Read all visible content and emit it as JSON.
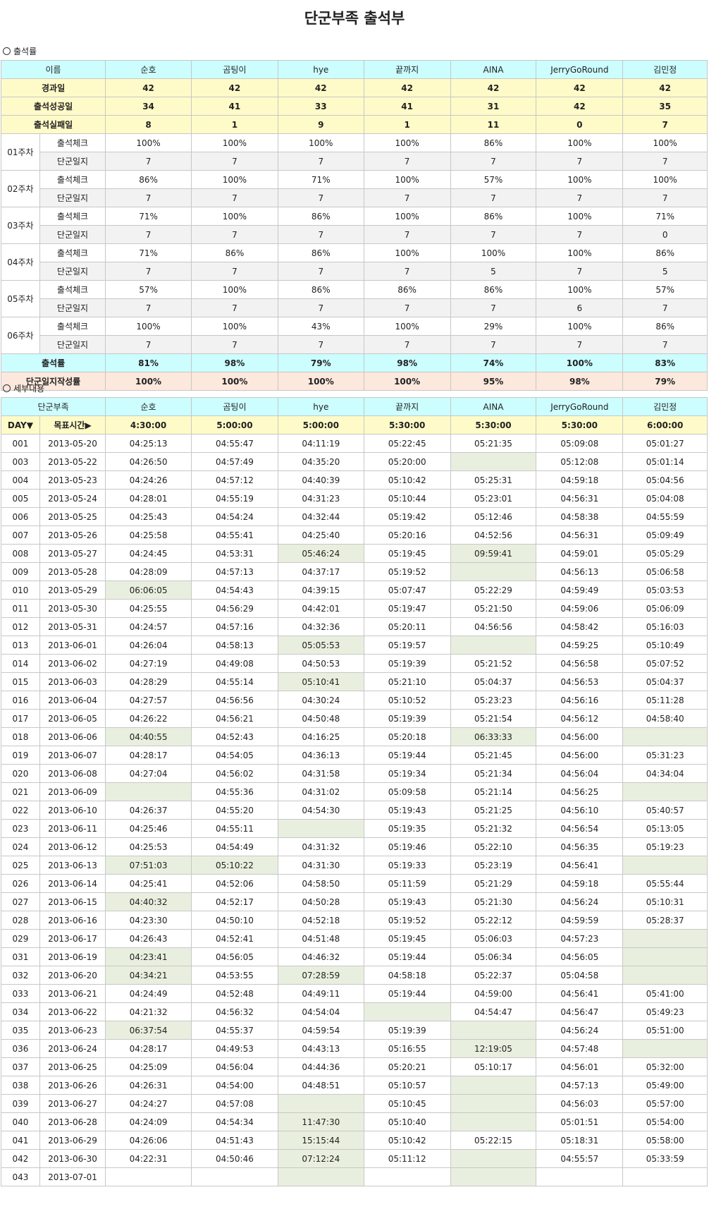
{
  "title": "단군부족 출석부",
  "section1": "출석률",
  "section2": "세부내용",
  "members": [
    "순호",
    "곰팅이",
    "hye",
    "끝까지",
    "AINA",
    "JerryGoRound",
    "김민정"
  ],
  "summary": {
    "name_label": "이름",
    "elapsed": {
      "label": "경과일",
      "values": [
        "42",
        "42",
        "42",
        "42",
        "42",
        "42",
        "42"
      ]
    },
    "success": {
      "label": "출석성공일",
      "values": [
        "34",
        "41",
        "33",
        "41",
        "31",
        "42",
        "35"
      ]
    },
    "fail": {
      "label": "출석실패일",
      "values": [
        "8",
        "1",
        "9",
        "1",
        "11",
        "0",
        "7"
      ]
    },
    "check_label": "출석체크",
    "journal_label": "단군일지",
    "weeks": [
      {
        "week": "01주차",
        "check": [
          "100%",
          "100%",
          "100%",
          "100%",
          "86%",
          "100%",
          "100%"
        ],
        "journal": [
          "7",
          "7",
          "7",
          "7",
          "7",
          "7",
          "7"
        ]
      },
      {
        "week": "02주차",
        "check": [
          "86%",
          "100%",
          "71%",
          "100%",
          "57%",
          "100%",
          "100%"
        ],
        "journal": [
          "7",
          "7",
          "7",
          "7",
          "7",
          "7",
          "7"
        ]
      },
      {
        "week": "03주차",
        "check": [
          "71%",
          "100%",
          "86%",
          "100%",
          "86%",
          "100%",
          "71%"
        ],
        "journal": [
          "7",
          "7",
          "7",
          "7",
          "7",
          "7",
          "0"
        ]
      },
      {
        "week": "04주차",
        "check": [
          "71%",
          "86%",
          "86%",
          "100%",
          "100%",
          "100%",
          "86%"
        ],
        "journal": [
          "7",
          "7",
          "7",
          "7",
          "5",
          "7",
          "5"
        ]
      },
      {
        "week": "05주차",
        "check": [
          "57%",
          "100%",
          "86%",
          "86%",
          "86%",
          "100%",
          "57%"
        ],
        "journal": [
          "7",
          "7",
          "7",
          "7",
          "7",
          "6",
          "7"
        ]
      },
      {
        "week": "06주차",
        "check": [
          "100%",
          "100%",
          "43%",
          "100%",
          "29%",
          "100%",
          "86%"
        ],
        "journal": [
          "7",
          "7",
          "7",
          "7",
          "7",
          "7",
          "7"
        ]
      }
    ],
    "attendance": {
      "label": "출석률",
      "values": [
        "81%",
        "98%",
        "79%",
        "98%",
        "74%",
        "100%",
        "83%"
      ]
    },
    "journal_rate": {
      "label": "단군일지작성률",
      "values": [
        "100%",
        "100%",
        "100%",
        "100%",
        "95%",
        "98%",
        "79%"
      ]
    }
  },
  "detail": {
    "tribe_label": "단군부족",
    "day_label": "DAY▼",
    "target_label": "목표시간▶",
    "targets": [
      "4:30:00",
      "5:00:00",
      "5:00:00",
      "5:30:00",
      "5:30:00",
      "5:30:00",
      "6:00:00"
    ],
    "rows": [
      {
        "day": "001",
        "date": "2013-05-20",
        "times": [
          "04:25:13",
          "04:55:47",
          "04:11:19",
          "05:22:45",
          "05:21:35",
          "05:09:08",
          "05:01:27"
        ],
        "miss": []
      },
      {
        "day": "003",
        "date": "2013-05-22",
        "times": [
          "04:26:50",
          "04:57:49",
          "04:35:20",
          "05:20:00",
          "",
          "05:12:08",
          "05:01:14"
        ],
        "miss": [
          4
        ]
      },
      {
        "day": "004",
        "date": "2013-05-23",
        "times": [
          "04:24:26",
          "04:57:12",
          "04:40:39",
          "05:10:42",
          "05:25:31",
          "04:59:18",
          "05:04:56"
        ],
        "miss": []
      },
      {
        "day": "005",
        "date": "2013-05-24",
        "times": [
          "04:28:01",
          "04:55:19",
          "04:31:23",
          "05:10:44",
          "05:23:01",
          "04:56:31",
          "05:04:08"
        ],
        "miss": []
      },
      {
        "day": "006",
        "date": "2013-05-25",
        "times": [
          "04:25:43",
          "04:54:24",
          "04:32:44",
          "05:19:42",
          "05:12:46",
          "04:58:38",
          "04:55:59"
        ],
        "miss": []
      },
      {
        "day": "007",
        "date": "2013-05-26",
        "times": [
          "04:25:58",
          "04:55:41",
          "04:25:40",
          "05:20:16",
          "04:52:56",
          "04:56:31",
          "05:09:49"
        ],
        "miss": []
      },
      {
        "day": "008",
        "date": "2013-05-27",
        "times": [
          "04:24:45",
          "04:53:31",
          "05:46:24",
          "05:19:45",
          "09:59:41",
          "04:59:01",
          "05:05:29"
        ],
        "miss": [
          2,
          4
        ]
      },
      {
        "day": "009",
        "date": "2013-05-28",
        "times": [
          "04:28:09",
          "04:57:13",
          "04:37:17",
          "05:19:52",
          "",
          "04:56:13",
          "05:06:58"
        ],
        "miss": [
          4
        ]
      },
      {
        "day": "010",
        "date": "2013-05-29",
        "times": [
          "06:06:05",
          "04:54:43",
          "04:39:15",
          "05:07:47",
          "05:22:29",
          "04:59:49",
          "05:03:53"
        ],
        "miss": [
          0
        ]
      },
      {
        "day": "011",
        "date": "2013-05-30",
        "times": [
          "04:25:55",
          "04:56:29",
          "04:42:01",
          "05:19:47",
          "05:21:50",
          "04:59:06",
          "05:06:09"
        ],
        "miss": []
      },
      {
        "day": "012",
        "date": "2013-05-31",
        "times": [
          "04:24:57",
          "04:57:16",
          "04:32:36",
          "05:20:11",
          "04:56:56",
          "04:58:42",
          "05:16:03"
        ],
        "miss": []
      },
      {
        "day": "013",
        "date": "2013-06-01",
        "times": [
          "04:26:04",
          "04:58:13",
          "05:05:53",
          "05:19:57",
          "",
          "04:59:25",
          "05:10:49"
        ],
        "miss": [
          2,
          4
        ]
      },
      {
        "day": "014",
        "date": "2013-06-02",
        "times": [
          "04:27:19",
          "04:49:08",
          "04:50:53",
          "05:19:39",
          "05:21:52",
          "04:56:58",
          "05:07:52"
        ],
        "miss": []
      },
      {
        "day": "015",
        "date": "2013-06-03",
        "times": [
          "04:28:29",
          "04:55:14",
          "05:10:41",
          "05:21:10",
          "05:04:37",
          "04:56:53",
          "05:04:37"
        ],
        "miss": [
          2
        ]
      },
      {
        "day": "016",
        "date": "2013-06-04",
        "times": [
          "04:27:57",
          "04:56:56",
          "04:30:24",
          "05:10:52",
          "05:23:23",
          "04:56:16",
          "05:11:28"
        ],
        "miss": []
      },
      {
        "day": "017",
        "date": "2013-06-05",
        "times": [
          "04:26:22",
          "04:56:21",
          "04:50:48",
          "05:19:39",
          "05:21:54",
          "04:56:12",
          "04:58:40"
        ],
        "miss": []
      },
      {
        "day": "018",
        "date": "2013-06-06",
        "times": [
          "04:40:55",
          "04:52:43",
          "04:16:25",
          "05:20:18",
          "06:33:33",
          "04:56:00",
          ""
        ],
        "miss": [
          0,
          4,
          6
        ]
      },
      {
        "day": "019",
        "date": "2013-06-07",
        "times": [
          "04:28:17",
          "04:54:05",
          "04:36:13",
          "05:19:44",
          "05:21:45",
          "04:56:00",
          "05:31:23"
        ],
        "miss": []
      },
      {
        "day": "020",
        "date": "2013-06-08",
        "times": [
          "04:27:04",
          "04:56:02",
          "04:31:58",
          "05:19:34",
          "05:21:34",
          "04:56:04",
          "04:34:04"
        ],
        "miss": []
      },
      {
        "day": "021",
        "date": "2013-06-09",
        "times": [
          "",
          "04:55:36",
          "04:31:02",
          "05:09:58",
          "05:21:14",
          "04:56:25",
          ""
        ],
        "miss": [
          0,
          6
        ]
      },
      {
        "day": "022",
        "date": "2013-06-10",
        "times": [
          "04:26:37",
          "04:55:20",
          "04:54:30",
          "05:19:43",
          "05:21:25",
          "04:56:10",
          "05:40:57"
        ],
        "miss": []
      },
      {
        "day": "023",
        "date": "2013-06-11",
        "times": [
          "04:25:46",
          "04:55:11",
          "",
          "05:19:35",
          "05:21:32",
          "04:56:54",
          "05:13:05"
        ],
        "miss": [
          2
        ]
      },
      {
        "day": "024",
        "date": "2013-06-12",
        "times": [
          "04:25:53",
          "04:54:49",
          "04:31:32",
          "05:19:46",
          "05:22:10",
          "04:56:35",
          "05:19:23"
        ],
        "miss": []
      },
      {
        "day": "025",
        "date": "2013-06-13",
        "times": [
          "07:51:03",
          "05:10:22",
          "04:31:30",
          "05:19:33",
          "05:23:19",
          "04:56:41",
          ""
        ],
        "miss": [
          0,
          1,
          6
        ]
      },
      {
        "day": "026",
        "date": "2013-06-14",
        "times": [
          "04:25:41",
          "04:52:06",
          "04:58:50",
          "05:11:59",
          "05:21:29",
          "04:59:18",
          "05:55:44"
        ],
        "miss": []
      },
      {
        "day": "027",
        "date": "2013-06-15",
        "times": [
          "04:40:32",
          "04:52:17",
          "04:50:28",
          "05:19:43",
          "05:21:30",
          "04:56:24",
          "05:10:31"
        ],
        "miss": [
          0
        ]
      },
      {
        "day": "028",
        "date": "2013-06-16",
        "times": [
          "04:23:30",
          "04:50:10",
          "04:52:18",
          "05:19:52",
          "05:22:12",
          "04:59:59",
          "05:28:37"
        ],
        "miss": []
      },
      {
        "day": "029",
        "date": "2013-06-17",
        "times": [
          "04:26:43",
          "04:52:41",
          "04:51:48",
          "05:19:45",
          "05:06:03",
          "04:57:23",
          ""
        ],
        "miss": [
          6
        ]
      },
      {
        "day": "031",
        "date": "2013-06-19",
        "times": [
          "04:23:41",
          "04:56:05",
          "04:46:32",
          "05:19:44",
          "05:06:34",
          "04:56:05",
          ""
        ],
        "miss": [
          0,
          6
        ],
        "cut": true
      },
      {
        "day": "032",
        "date": "2013-06-20",
        "times": [
          "04:34:21",
          "04:53:55",
          "07:28:59",
          "04:58:18",
          "05:22:37",
          "05:04:58",
          ""
        ],
        "miss": [
          0,
          2,
          6
        ]
      },
      {
        "day": "033",
        "date": "2013-06-21",
        "times": [
          "04:24:49",
          "04:52:48",
          "04:49:11",
          "05:19:44",
          "04:59:00",
          "04:56:41",
          "05:41:00"
        ],
        "miss": []
      },
      {
        "day": "034",
        "date": "2013-06-22",
        "times": [
          "04:21:32",
          "04:56:32",
          "04:54:04",
          "",
          "04:54:47",
          "04:56:47",
          "05:49:23"
        ],
        "miss": [
          3
        ]
      },
      {
        "day": "035",
        "date": "2013-06-23",
        "times": [
          "06:37:54",
          "04:55:37",
          "04:59:54",
          "05:19:39",
          "",
          "04:56:24",
          "05:51:00"
        ],
        "miss": [
          0,
          4
        ]
      },
      {
        "day": "036",
        "date": "2013-06-24",
        "times": [
          "04:28:17",
          "04:49:53",
          "04:43:13",
          "05:16:55",
          "12:19:05",
          "04:57:48",
          ""
        ],
        "miss": [
          4,
          6
        ]
      },
      {
        "day": "037",
        "date": "2013-06-25",
        "times": [
          "04:25:09",
          "04:56:04",
          "04:44:36",
          "05:20:21",
          "05:10:17",
          "04:56:01",
          "05:32:00"
        ],
        "miss": []
      },
      {
        "day": "038",
        "date": "2013-06-26",
        "times": [
          "04:26:31",
          "04:54:00",
          "04:48:51",
          "05:10:57",
          "",
          "04:57:13",
          "05:49:00"
        ],
        "miss": [
          4
        ]
      },
      {
        "day": "039",
        "date": "2013-06-27",
        "times": [
          "04:24:27",
          "04:57:08",
          "",
          "05:10:45",
          "",
          "04:56:03",
          "05:57:00"
        ],
        "miss": [
          2,
          4
        ]
      },
      {
        "day": "040",
        "date": "2013-06-28",
        "times": [
          "04:24:09",
          "04:54:34",
          "11:47:30",
          "05:10:40",
          "",
          "05:01:51",
          "05:54:00"
        ],
        "miss": [
          2,
          4
        ]
      },
      {
        "day": "041",
        "date": "2013-06-29",
        "times": [
          "04:26:06",
          "04:51:43",
          "15:15:44",
          "05:10:42",
          "05:22:15",
          "05:18:31",
          "05:58:00"
        ],
        "miss": [
          2
        ]
      },
      {
        "day": "042",
        "date": "2013-06-30",
        "times": [
          "04:22:31",
          "04:50:46",
          "07:12:24",
          "05:11:12",
          "",
          "04:55:57",
          "05:33:59"
        ],
        "miss": [
          2,
          4
        ]
      },
      {
        "day": "043",
        "date": "2013-07-01",
        "times": [
          "",
          "",
          "",
          "",
          "",
          "",
          ""
        ],
        "miss": [
          2,
          4
        ],
        "cut": true
      }
    ]
  }
}
